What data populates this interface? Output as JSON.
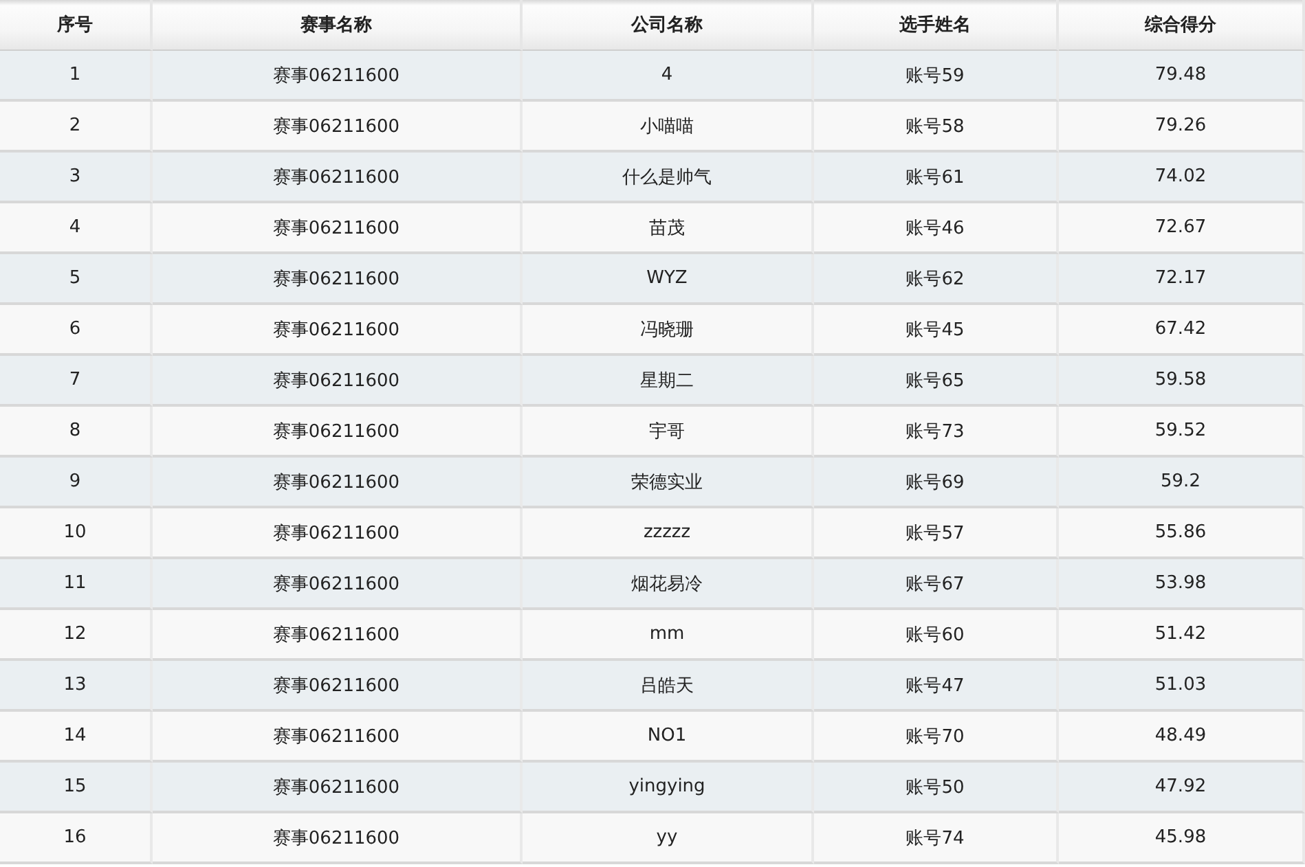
{
  "table": {
    "columns": [
      "序号",
      "赛事名称",
      "公司名称",
      "选手姓名",
      "综合得分"
    ],
    "rows": [
      [
        "1",
        "赛事06211600",
        "4",
        "账号59",
        "79.48"
      ],
      [
        "2",
        "赛事06211600",
        "小喵喵",
        "账号58",
        "79.26"
      ],
      [
        "3",
        "赛事06211600",
        "什么是帅气",
        "账号61",
        "74.02"
      ],
      [
        "4",
        "赛事06211600",
        "苗茂",
        "账号46",
        "72.67"
      ],
      [
        "5",
        "赛事06211600",
        "WYZ",
        "账号62",
        "72.17"
      ],
      [
        "6",
        "赛事06211600",
        "冯晓珊",
        "账号45",
        "67.42"
      ],
      [
        "7",
        "赛事06211600",
        "星期二",
        "账号65",
        "59.58"
      ],
      [
        "8",
        "赛事06211600",
        "宇哥",
        "账号73",
        "59.52"
      ],
      [
        "9",
        "赛事06211600",
        "荣德实业",
        "账号69",
        "59.2"
      ],
      [
        "10",
        "赛事06211600",
        "zzzzz",
        "账号57",
        "55.86"
      ],
      [
        "11",
        "赛事06211600",
        "烟花易冷",
        "账号67",
        "53.98"
      ],
      [
        "12",
        "赛事06211600",
        "mm",
        "账号60",
        "51.42"
      ],
      [
        "13",
        "赛事06211600",
        "吕皓天",
        "账号47",
        "51.03"
      ],
      [
        "14",
        "赛事06211600",
        "NO1",
        "账号70",
        "48.49"
      ],
      [
        "15",
        "赛事06211600",
        "yingying",
        "账号50",
        "47.92"
      ],
      [
        "16",
        "赛事06211600",
        "yy",
        "账号74",
        "45.98"
      ]
    ]
  }
}
